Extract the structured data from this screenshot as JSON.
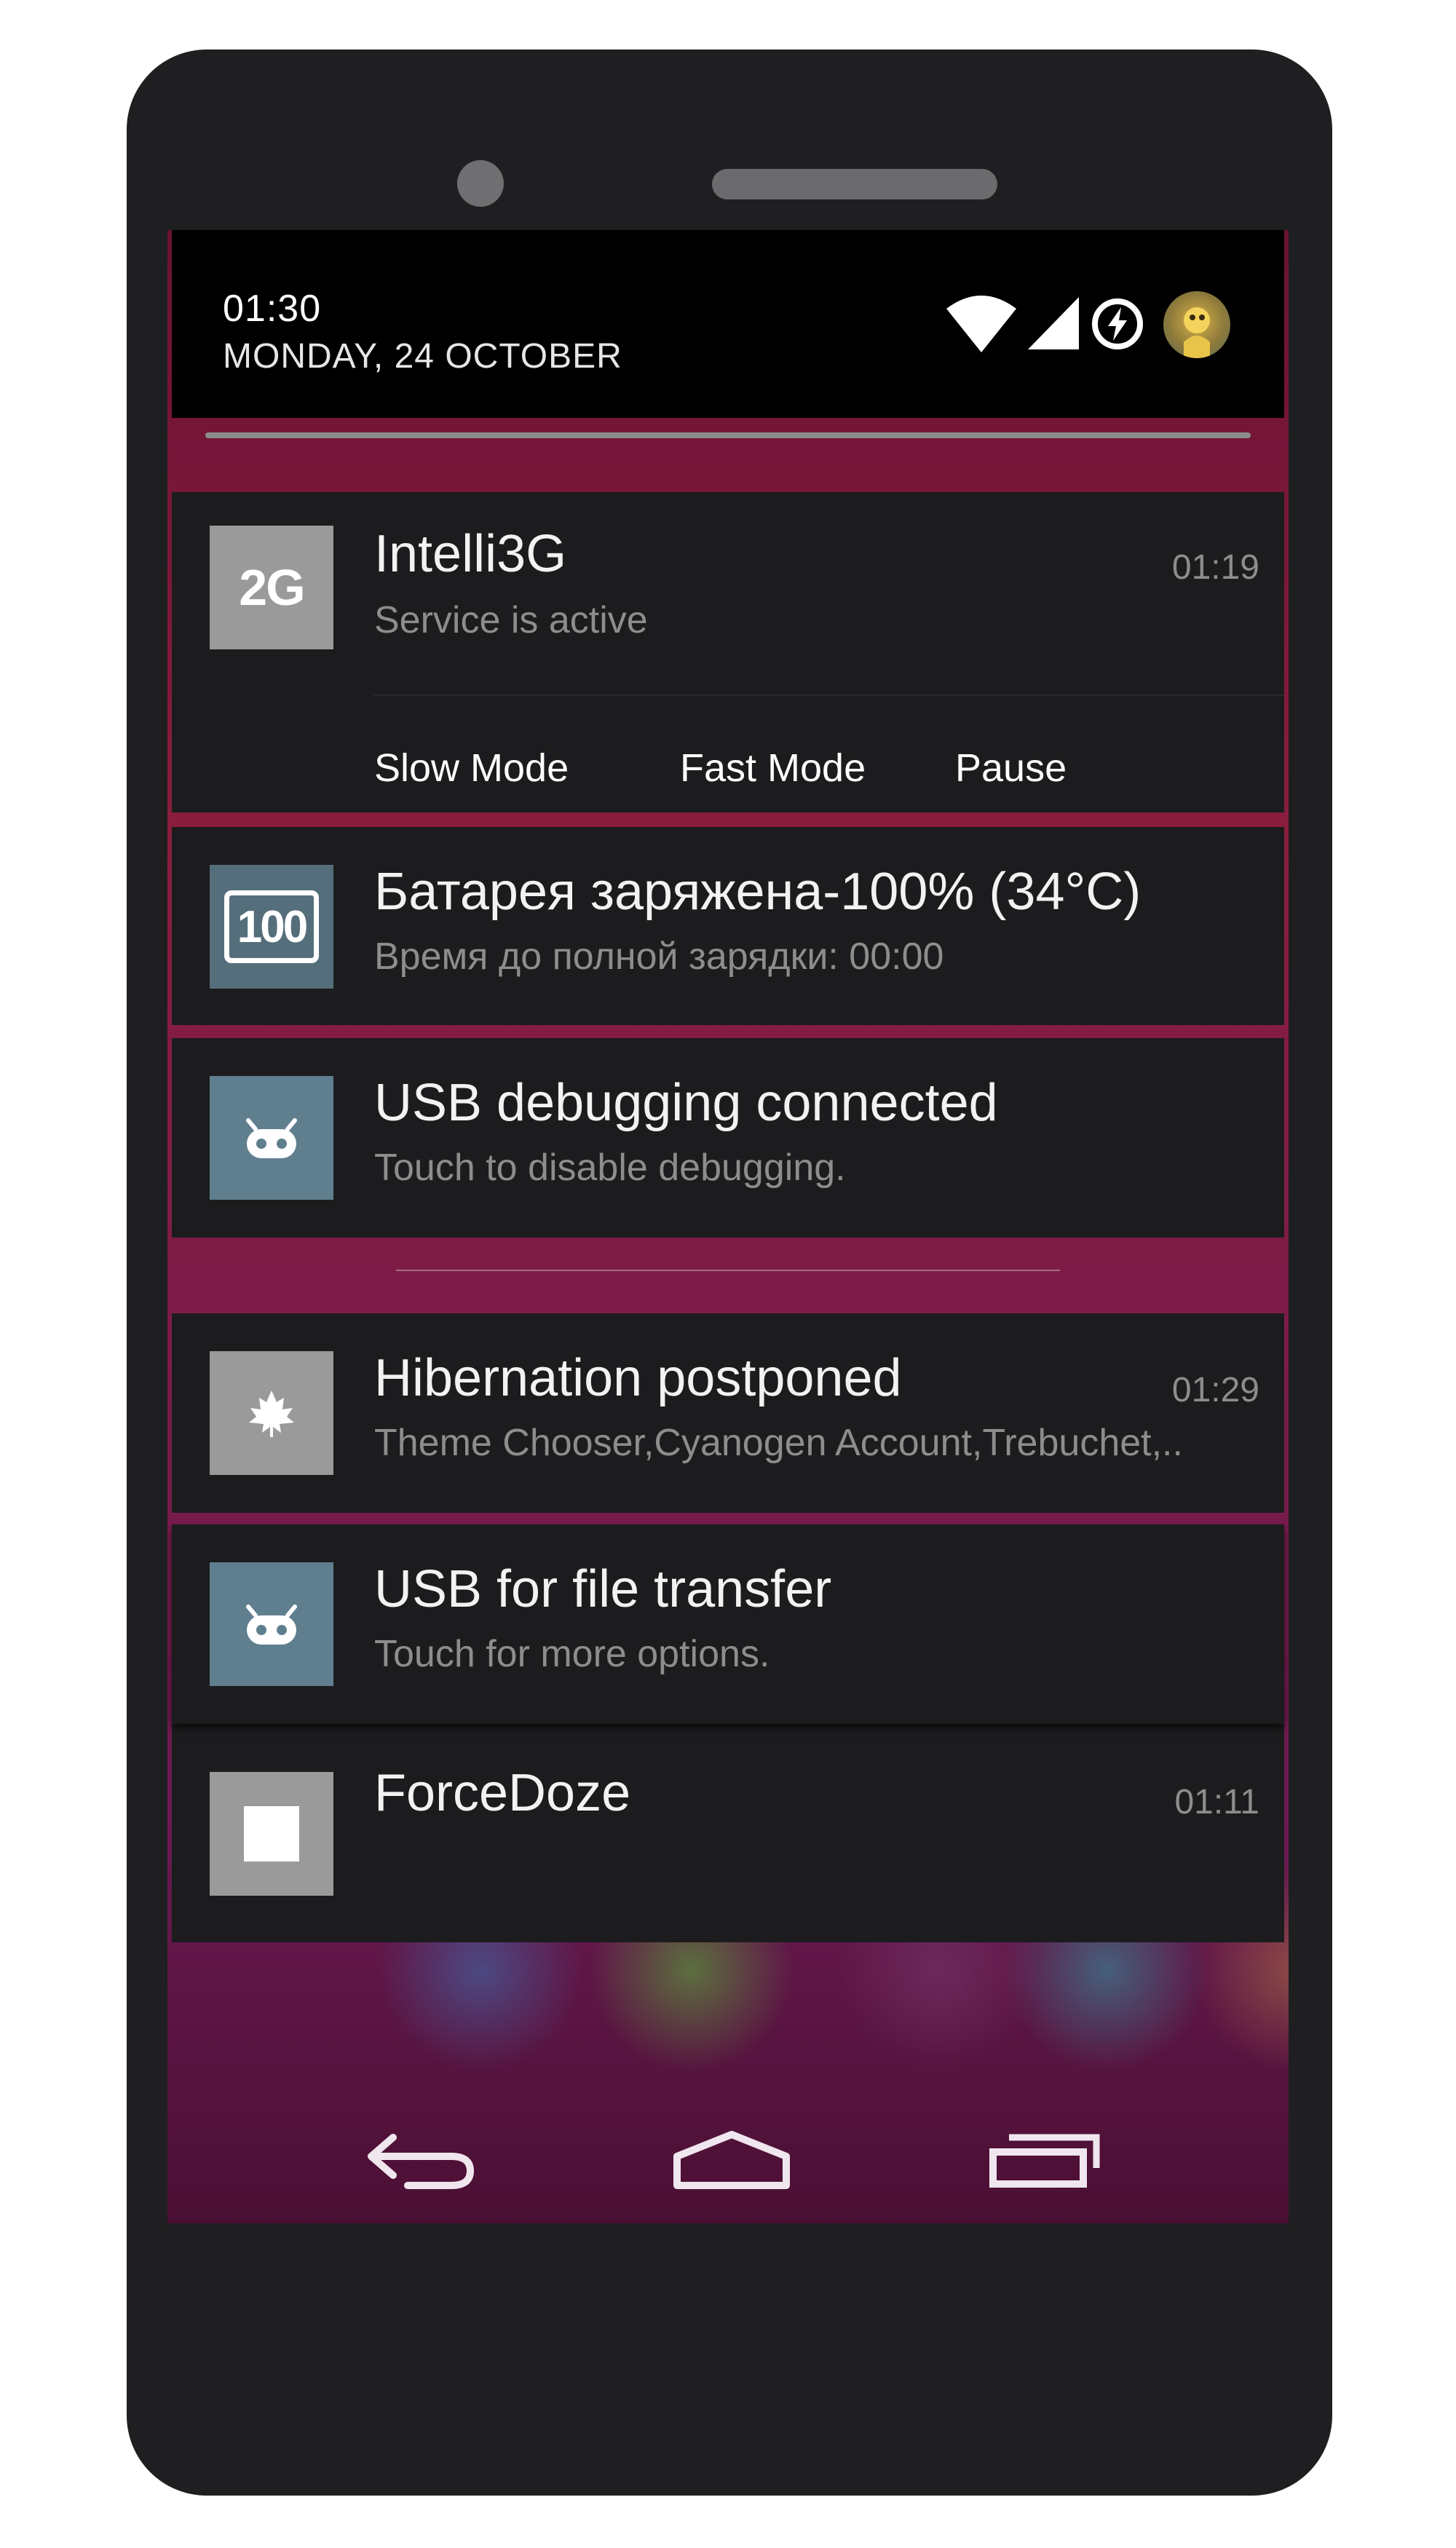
{
  "status": {
    "time": "01:30",
    "date": "MONDAY, 24 OCTOBER",
    "icons": [
      "wifi-icon",
      "signal-icon",
      "battery-charging-icon",
      "avatar"
    ]
  },
  "notifications": [
    {
      "app_icon_label": "2G",
      "title": "Intelli3G",
      "text": "Service is active",
      "time": "01:19",
      "actions": [
        "Slow Mode",
        "Fast Mode",
        "Pause"
      ]
    },
    {
      "app_icon_label": "100",
      "title": "Батарея заряжена-100% (34°C)",
      "text": "Время до полной зарядки: 00:00"
    },
    {
      "app_icon": "cyanogen-icon",
      "title": "USB debugging connected",
      "text": "Touch to disable debugging."
    },
    {
      "app_icon": "maple-leaf-icon",
      "title": "Hibernation postponed",
      "text": "Theme Chooser,Cyanogen Account,Trebuchet,..",
      "time": "01:29"
    },
    {
      "app_icon": "cyanogen-icon",
      "title": "USB for file transfer",
      "text": "Touch for more options."
    },
    {
      "app_icon": "square-icon",
      "title": "ForceDoze",
      "time": "01:11"
    }
  ],
  "navigation": [
    "back-icon",
    "home-icon",
    "recents-icon"
  ],
  "colors": {
    "frame": "#1f1f21",
    "card": "#1c1c1e",
    "wallpaper": "#7a1c4a",
    "header": "#000000"
  }
}
